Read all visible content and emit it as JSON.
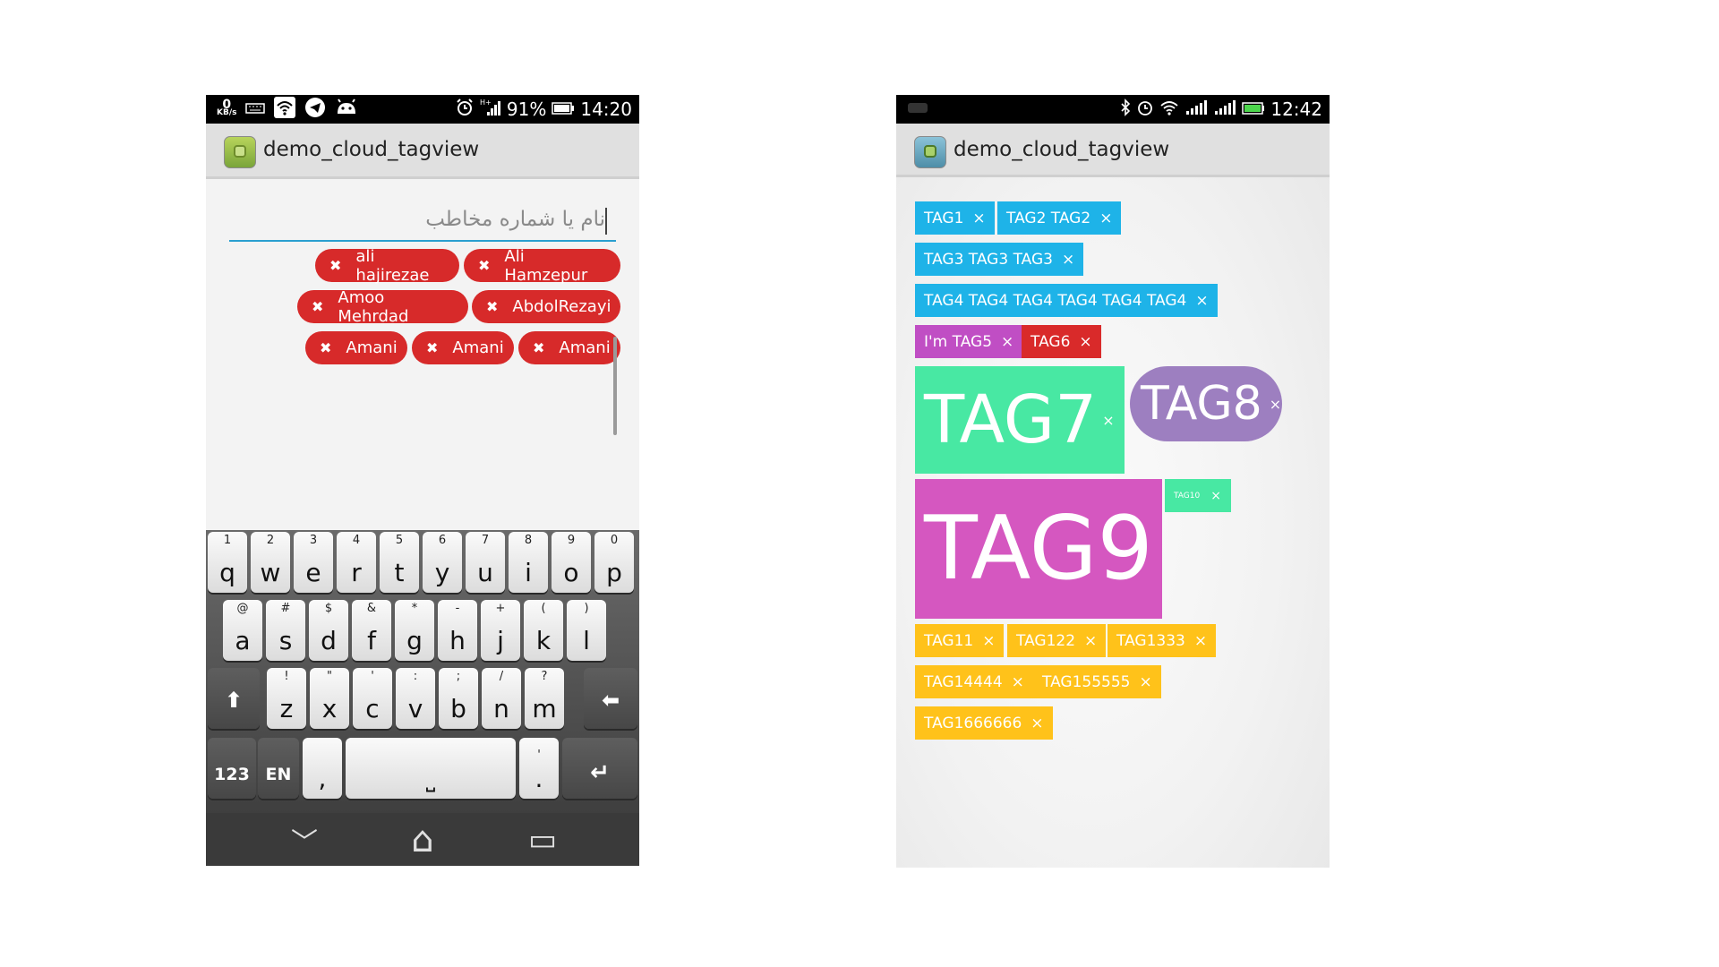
{
  "left_phone": {
    "status": {
      "speed_value": "0",
      "speed_unit": "KB/s",
      "battery": "91%",
      "time": "14:20"
    },
    "app_title": "demo_cloud_tagview",
    "search": {
      "placeholder": "نام یا شماره مخاطب"
    },
    "chips": [
      {
        "label": "ali hajirezae"
      },
      {
        "label": "Ali Hamzepur"
      },
      {
        "label": "Amoo Mehrdad"
      },
      {
        "label": "AbdolRezayi"
      },
      {
        "label": "Amani"
      },
      {
        "label": "Amani"
      },
      {
        "label": "Amani"
      }
    ],
    "chip_color": "#d72a2a",
    "keyboard": {
      "row1": [
        {
          "hint": "1",
          "key": "q"
        },
        {
          "hint": "2",
          "key": "w"
        },
        {
          "hint": "3",
          "key": "e"
        },
        {
          "hint": "4",
          "key": "r"
        },
        {
          "hint": "5",
          "key": "t"
        },
        {
          "hint": "6",
          "key": "y"
        },
        {
          "hint": "7",
          "key": "u"
        },
        {
          "hint": "8",
          "key": "i"
        },
        {
          "hint": "9",
          "key": "o"
        },
        {
          "hint": "0",
          "key": "p"
        }
      ],
      "row2": [
        {
          "hint": "@",
          "key": "a"
        },
        {
          "hint": "#",
          "key": "s"
        },
        {
          "hint": "$",
          "key": "d"
        },
        {
          "hint": "&",
          "key": "f"
        },
        {
          "hint": "*",
          "key": "g"
        },
        {
          "hint": "-",
          "key": "h"
        },
        {
          "hint": "+",
          "key": "j"
        },
        {
          "hint": "(",
          "key": "k"
        },
        {
          "hint": ")",
          "key": "l"
        }
      ],
      "row3": [
        {
          "hint": "!",
          "key": "z"
        },
        {
          "hint": "\"",
          "key": "x"
        },
        {
          "hint": "'",
          "key": "c"
        },
        {
          "hint": ":",
          "key": "v"
        },
        {
          "hint": ";",
          "key": "b"
        },
        {
          "hint": "/",
          "key": "n"
        },
        {
          "hint": "?",
          "key": "m"
        }
      ],
      "shift": "⬆",
      "backspace": "⬅",
      "num_label": "123",
      "lang_label": "EN",
      "comma": ",",
      "space": "⎵",
      "period_hint": "'",
      "period": ".",
      "enter": "↵"
    },
    "nav": {
      "back": "﹀",
      "home": "⌂",
      "recent": "▭"
    }
  },
  "right_phone": {
    "status": {
      "time": "12:42"
    },
    "app_title": "demo_cloud_tagview",
    "tags": [
      {
        "label": "TAG1",
        "color": "#1eb3e8"
      },
      {
        "label": "TAG2 TAG2",
        "color": "#1eb3e8"
      },
      {
        "label": "TAG3 TAG3 TAG3",
        "color": "#1eb3e8"
      },
      {
        "label": "TAG4 TAG4 TAG4 TAG4 TAG4 TAG4",
        "color": "#1eb3e8"
      },
      {
        "label": "I'm TAG5",
        "color": "#c04ec4"
      },
      {
        "label": "TAG6",
        "color": "#d92a2a"
      },
      {
        "label": "TAG7",
        "color": "#48e8a3"
      },
      {
        "label": "TAG8",
        "color": "#9d7fc0"
      },
      {
        "label": "TAG9",
        "color": "#d557c0"
      },
      {
        "label": "TAG10",
        "color": "#48e8a3"
      },
      {
        "label": "TAG11",
        "color": "#ffc21a"
      },
      {
        "label": "TAG122",
        "color": "#ffc21a"
      },
      {
        "label": "TAG1333",
        "color": "#ffc21a"
      },
      {
        "label": "TAG14444",
        "color": "#ffc21a"
      },
      {
        "label": "TAG155555",
        "color": "#ffc21a"
      },
      {
        "label": "TAG1666666",
        "color": "#ffc21a"
      }
    ],
    "remove_symbol": "×"
  }
}
